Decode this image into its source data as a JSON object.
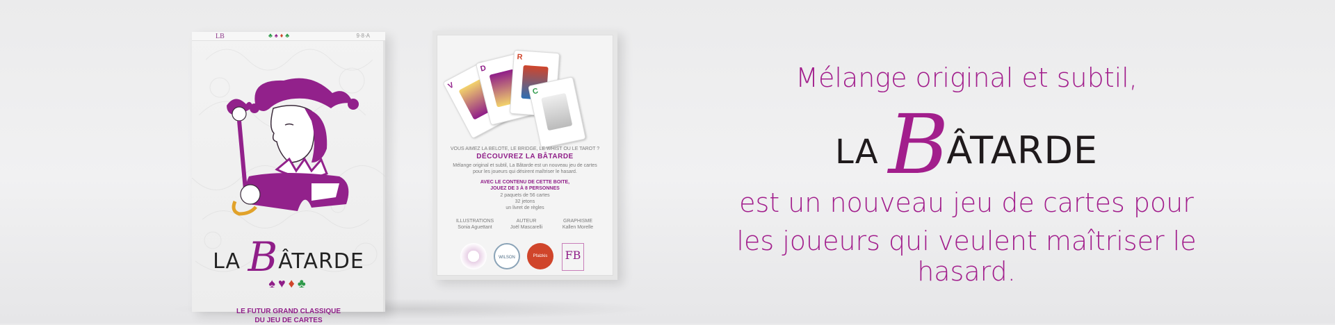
{
  "front_box": {
    "top_edge_logo": "LB",
    "top_edge_right": "9·8·A",
    "title_prefix": "LA",
    "title_initial": "B",
    "title_rest": "ÂTARDE",
    "suits": [
      "♠",
      "♥",
      "♦",
      "♣"
    ],
    "tagline_line1": "LE FUTUR GRAND CLASSIQUE",
    "tagline_line2": "DU JEU DE CARTES"
  },
  "back_box": {
    "intro": "VOUS AIMEZ LA BELOTE, LE BRIDGE, LE WHIST OU LE TAROT ?",
    "cta": "DÉCOUVREZ LA BÂTARDE",
    "desc_line1": "Mélange original et subtil, La Bâtarde est un nouveau jeu de cartes",
    "desc_line2": "pour les joueurs qui désirent maîtriser le hasard.",
    "contents_heading": "AVEC LE CONTENU DE CETTE BOITE,",
    "players": "JOUEZ DE 3 À 8 PERSONNES",
    "contents_1": "2 paquets de 56 cartes",
    "contents_2": "32 jetons",
    "contents_3": "un livret de règles",
    "credit_1_role": "ILLUSTRATIONS",
    "credit_1_name": "Sonia Aguettant",
    "credit_2_role": "AUTEUR",
    "credit_2_name": "Joël Mascarelli",
    "credit_3_role": "GRAPHISME",
    "credit_3_name": "Kallen Morelle",
    "logo_2": "WILSON",
    "logo_3": "Pfalzkis",
    "logo_4": "FB",
    "card_indices": [
      "V",
      "D",
      "R",
      "C"
    ]
  },
  "headline": {
    "line1": "Mélange original et subtil,",
    "brand_prefix": "LA",
    "brand_initial": "B",
    "brand_rest": "ÂTARDE",
    "line3": "est un nouveau jeu de cartes pour",
    "line4": "les joueurs qui veulent maîtriser le hasard."
  },
  "colors": {
    "accent": "#a21e8c",
    "dark_text": "#1f1a1c",
    "background": "#efeff0"
  }
}
